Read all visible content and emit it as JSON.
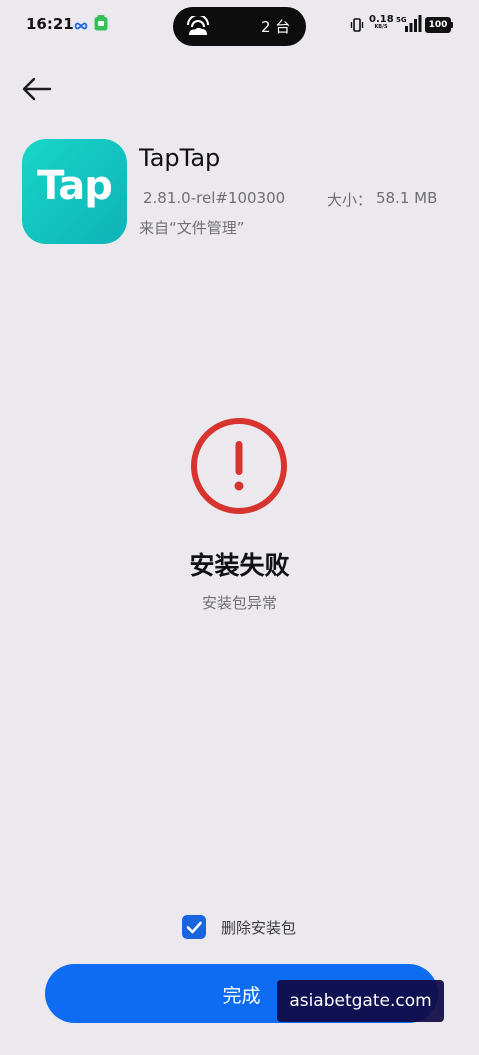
{
  "status_bar": {
    "time": "16:21",
    "icons_left": [
      "infinity-link-icon",
      "green-app-notification-icon"
    ],
    "pill_icon": "cloud-hotspot-icon",
    "pill_text": "2 台",
    "net_speed_value": "0.18",
    "net_speed_unit": "KB/S",
    "icons_right": [
      "vibrate-icon",
      "5g-icon",
      "signal-icon"
    ],
    "battery": "100"
  },
  "nav": {
    "back_icon": "arrow-left-icon"
  },
  "app": {
    "icon_text": "Tap",
    "icon_color": "#14c7c2",
    "name": "TapTap",
    "version": "2.81.0-rel#100300",
    "size_label": "大小：",
    "size": "58.1 MB",
    "source": "来自“文件管理”"
  },
  "result": {
    "icon": "exclamation-circle-icon",
    "icon_color": "#d7342f",
    "title": "安装失败",
    "description": "安装包异常"
  },
  "footer": {
    "delete_checked": true,
    "delete_label": "删除安装包",
    "done_label": "完成",
    "accent_color": "#0d6cf2"
  },
  "watermark": {
    "text": "asiabetgate.com"
  }
}
